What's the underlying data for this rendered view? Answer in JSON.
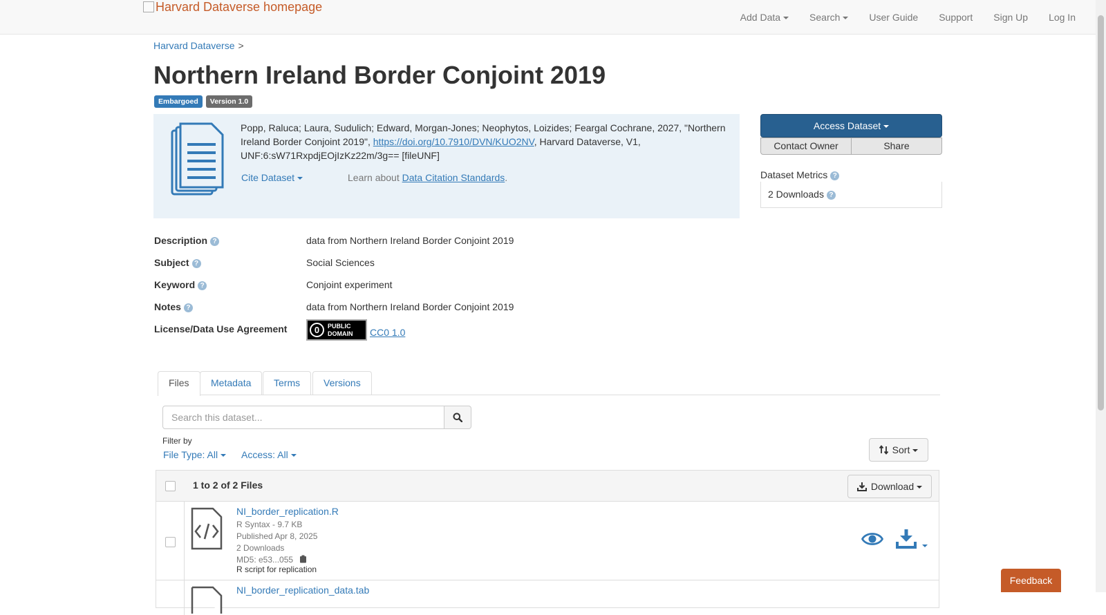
{
  "navbar": {
    "brand": "Harvard Dataverse homepage",
    "links": [
      "Add Data",
      "Search",
      "User Guide",
      "Support",
      "Sign Up",
      "Log In"
    ]
  },
  "breadcrumb": {
    "root": "Harvard Dataverse",
    "sep": ">"
  },
  "dataset": {
    "title": "Northern Ireland Border Conjoint 2019",
    "labels": {
      "embargoed": "Embargoed",
      "version": "Version 1.0"
    }
  },
  "citation": {
    "text_before": "Popp, Raluca; Laura, Sudulich; Edward, Morgan-Jones; Neophytos, Loizides; Feargal Cochrane, 2027, \"Northern Ireland Border Conjoint 2019\", ",
    "doi": "https://doi.org/10.7910/DVN/KUO2NV",
    "text_after": ", Harvard Dataverse, V1, UNF:6:sW71RxpdjEOjIzKz22m/3g== [fileUNF]",
    "cite_button": "Cite Dataset",
    "learn_prefix": "Learn about ",
    "learn_link": "Data Citation Standards",
    "learn_suffix": "."
  },
  "actions": {
    "access": "Access Dataset",
    "contact": "Contact Owner",
    "share": "Share"
  },
  "metrics": {
    "heading": "Dataset Metrics",
    "downloads": "2 Downloads"
  },
  "metadata": {
    "description_k": "Description",
    "description_v": "data from Northern Ireland Border Conjoint 2019",
    "subject_k": "Subject",
    "subject_v": "Social Sciences",
    "keyword_k": "Keyword",
    "keyword_v": "Conjoint experiment",
    "notes_k": "Notes",
    "notes_v": "data from Northern Ireland Border Conjoint 2019",
    "license_k": "License/Data Use Agreement",
    "license_v": "CC0 1.0",
    "badge_line1": "PUBLIC",
    "badge_line2": "DOMAIN"
  },
  "tabs": [
    "Files",
    "Metadata",
    "Terms",
    "Versions"
  ],
  "files": {
    "search_placeholder": "Search this dataset...",
    "filter_by": "Filter by",
    "file_type": "File Type: All",
    "access": "Access: All",
    "sort": "Sort",
    "count": "1 to 2 of 2 Files",
    "download": "Download",
    "items": [
      {
        "name": "NI_border_replication.R",
        "type_size": "R Syntax - 9.7 KB",
        "published": "Published Apr 8, 2025",
        "downloads": "2 Downloads",
        "md5": "MD5: e53...055",
        "description": "R script for replication"
      },
      {
        "name": "NI_border_replication_data.tab"
      }
    ]
  },
  "feedback": "Feedback",
  "colors": {
    "link": "#337ab7",
    "primary_button": "#286090",
    "brand": "#c55b28",
    "citation_bg": "#eaf2f8"
  }
}
